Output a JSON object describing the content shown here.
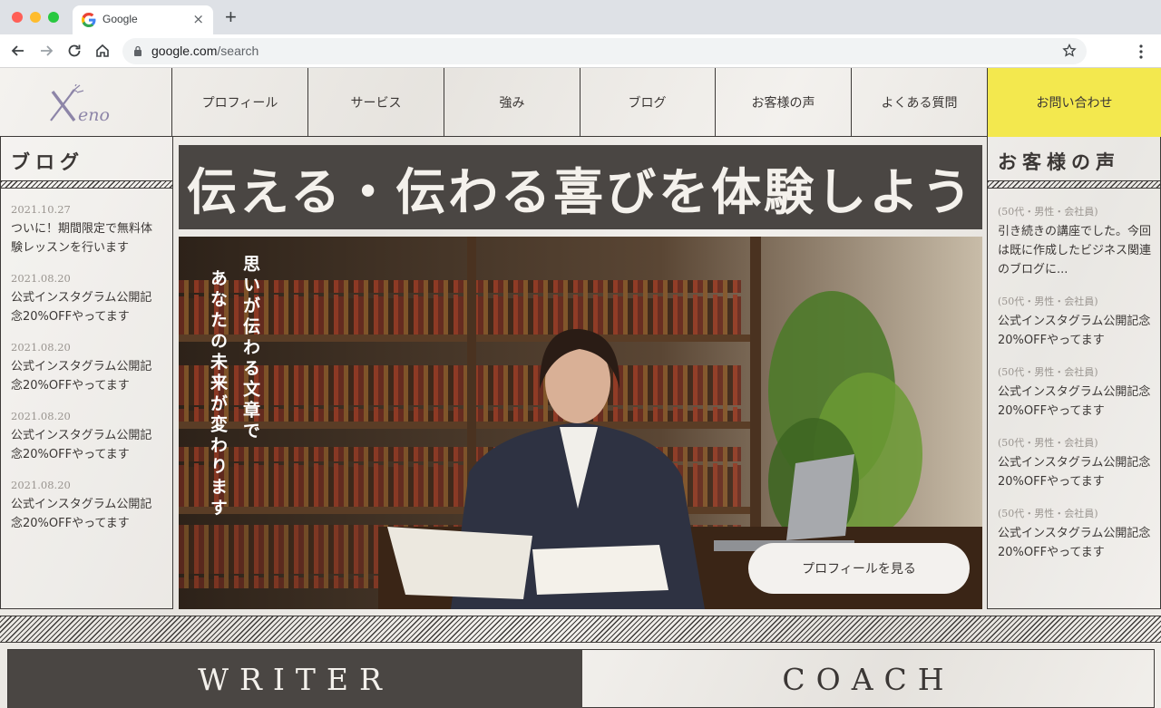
{
  "browser": {
    "tab_title": "Google",
    "tab_close": "×",
    "new_tab": "+",
    "url_domain": "google.com",
    "url_path": "/search"
  },
  "nav": {
    "items": [
      "プロフィール",
      "サービス",
      "強み",
      "ブログ",
      "お客様の声",
      "よくある質問"
    ],
    "contact": "お問い合わせ"
  },
  "blog": {
    "title": "ブログ",
    "posts": [
      {
        "date": "2021.10.27",
        "text": "ついに！期間限定で無料体験レッスンを行います"
      },
      {
        "date": "2021.08.20",
        "text": "公式インスタグラム公開記念20%OFFやってます"
      },
      {
        "date": "2021.08.20",
        "text": "公式インスタグラム公開記念20%OFFやってます"
      },
      {
        "date": "2021.08.20",
        "text": "公式インスタグラム公開記念20%OFFやってます"
      },
      {
        "date": "2021.08.20",
        "text": "公式インスタグラム公開記念20%OFFやってます"
      }
    ]
  },
  "voices": {
    "title": "お客様の声",
    "items": [
      {
        "meta": "(50代・男性・会社員)",
        "text": "引き続きの講座でした。今回は既に作成したビジネス関連のブログに..."
      },
      {
        "meta": "(50代・男性・会社員)",
        "text": "公式インスタグラム公開記念20%OFFやってます"
      },
      {
        "meta": "(50代・男性・会社員)",
        "text": "公式インスタグラム公開記念20%OFFやってます"
      },
      {
        "meta": "(50代・男性・会社員)",
        "text": "公式インスタグラム公開記念20%OFFやってます"
      },
      {
        "meta": "(50代・男性・会社員)",
        "text": "公式インスタグラム公開記念20%OFFやってます"
      }
    ]
  },
  "hero": {
    "headline": "伝える・伝わる喜びを体験しよう",
    "vertical_1": "思いが伝わる文章で",
    "vertical_2": "あなたの未来が変わります",
    "button": "プロフィールを見る"
  },
  "sections": {
    "writer": "WRITER",
    "coach": "COACH"
  },
  "logo": {
    "text": "eno"
  },
  "colors": {
    "accent_yellow": "#f3e84e",
    "dark_panel": "#4a4643",
    "paper": "#eeebe6"
  }
}
